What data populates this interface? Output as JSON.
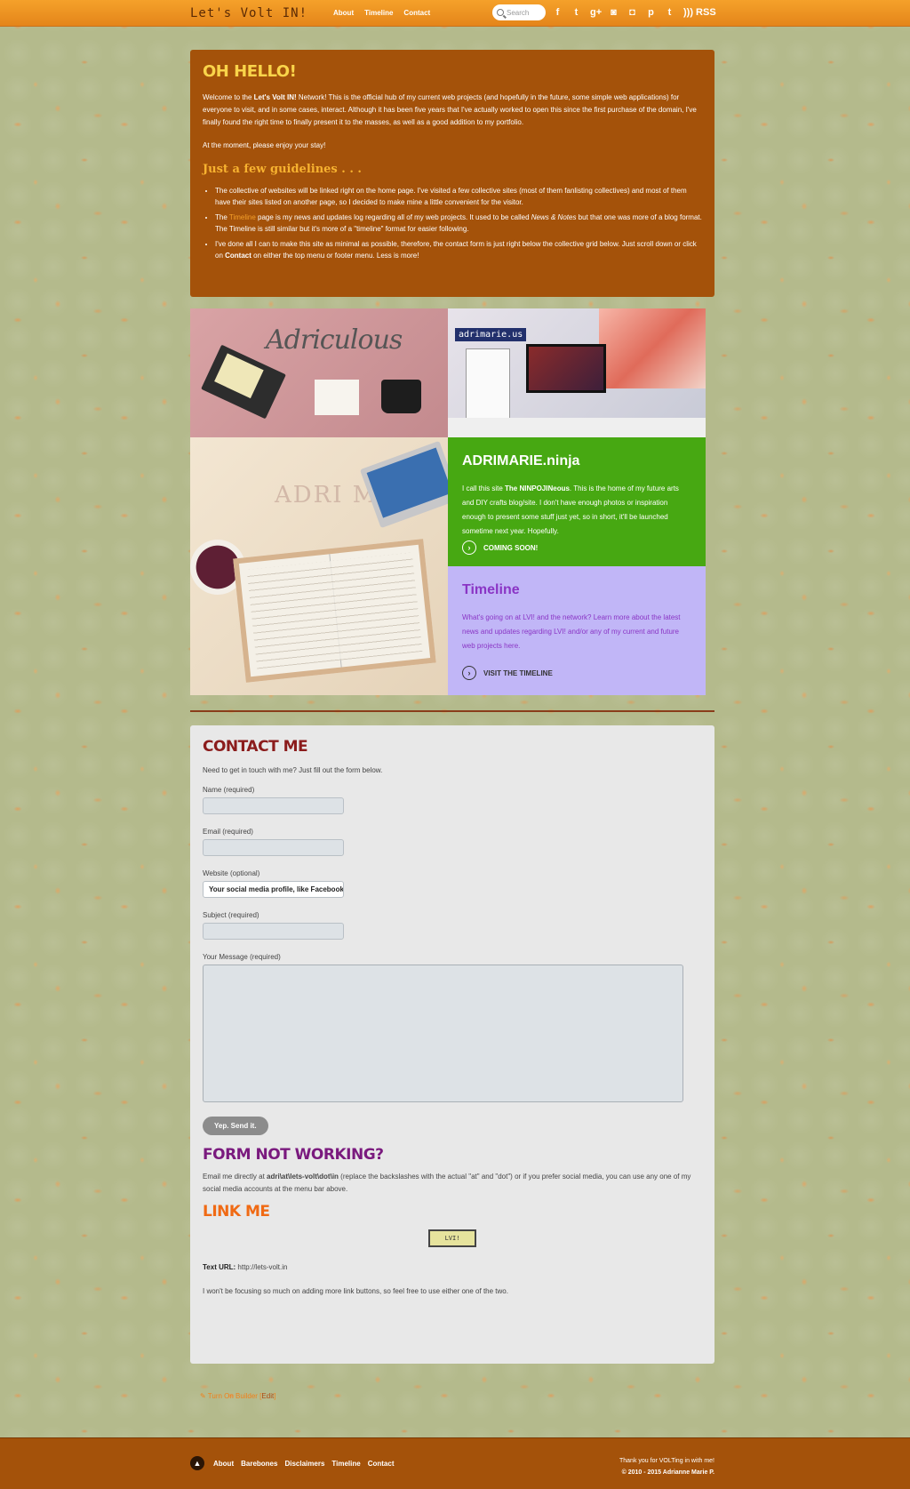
{
  "header": {
    "logo": "Let's Volt IN!",
    "nav": [
      "About",
      "Timeline",
      "Contact"
    ],
    "search_placeholder": "Search",
    "social_icons": [
      "facebook-icon",
      "twitter-icon",
      "google-plus-icon",
      "game-icon",
      "instagram-icon",
      "pinterest-icon",
      "tumblr-icon"
    ],
    "rss": "RSS"
  },
  "hello": {
    "title": "OH HELLO!",
    "p1_a": "Welcome to the ",
    "p1_strong": "Let's Volt IN!",
    "p1_b": " Network! This is the official hub of my current web projects (and hopefully in the future, some simple web applications) for everyone to visit, and in some cases, interact. Although it has been five years that I've actually worked to open this since the first purchase of the domain, I've finally found the right time to finally present it to the masses, as well as a good addition to my portfolio.",
    "p2": "At the moment, please enjoy your stay!",
    "guidelines_title": "Just a few guidelines . . .",
    "g1": "The collective of websites will be linked right on the home page. I've visited a few collective sites (most of them fanlisting collectives) and most of them have their sites listed on another page, so I decided to make mine a little convenient for the visitor.",
    "g2_a": "The ",
    "g2_link": "Timeline",
    "g2_b": " page is my news and updates log regarding all of my web projects. It used to be called ",
    "g2_em": "News & Notes",
    "g2_c": " but that one was more of a blog format. The Timeline is still similar but it's more of a \"timeline\" format for easier following.",
    "g3_a": "I've done all I can to make this site as minimal as possible, therefore, the contact form is just right below the collective grid below. Just scroll down or click on ",
    "g3_strong": "Contact",
    "g3_b": " on either the top menu or footer menu. Less is more!"
  },
  "grid": {
    "tile1_text": "Adriculous",
    "tile2_text": "adrimarie.us",
    "tile3_text": "ADRI MARS",
    "ninja": {
      "title": "ADRIMARIE.ninja",
      "text_a": "I call this site ",
      "text_strong": "The NINPOJINeous",
      "text_b": ". This is the home of my future arts and DIY crafts blog/site. I don't have enough photos or inspiration enough to present some stuff just yet, so in short, it'll be launched sometime next year. Hopefully.",
      "cta": "COMING SOON!",
      "color": "#47a812"
    },
    "timeline": {
      "title": "Timeline",
      "text": "What's going on at LVI! and the network? Learn more about the latest news and updates regarding LVI! and/or any of my current and future web projects here.",
      "cta": "VISIT THE TIMELINE",
      "color": "#c1b6f7"
    }
  },
  "contact": {
    "title": "CONTACT ME",
    "intro": "Need to get in touch with me? Just fill out the form below.",
    "name_label": "Name (required)",
    "email_label": "Email (required)",
    "website_label": "Website (optional)",
    "website_value": "Your social media profile, like Facebook",
    "subject_label": "Subject (required)",
    "message_label": "Your Message (required)",
    "send": "Yep. Send it.",
    "fnw_title": "FORM NOT WORKING?",
    "fnw_a": "Email me directly at ",
    "fnw_strong": "adri\\at\\lets-volt\\dot\\in",
    "fnw_b": " (replace the backslashes with the actual \"at\" and \"dot\") or if you prefer social media, you can use any one of my social media accounts at the menu bar above.",
    "link_title": "LINK ME",
    "button_text": "LVI!",
    "url_label": "Text URL:",
    "url_value": " http://lets-volt.in",
    "final": "I won't be focusing so much on adding more link buttons, so feel free to use either one of the two."
  },
  "builder": {
    "label": "Turn On Builder",
    "edit": "Edit"
  },
  "footer": {
    "nav": [
      "About",
      "Barebones",
      "Disclaimers",
      "Timeline",
      "Contact"
    ],
    "thanks": "Thank you for VOLTing in with me!",
    "copyright": "© 2010 - 2015 Adrianne Marie P."
  }
}
